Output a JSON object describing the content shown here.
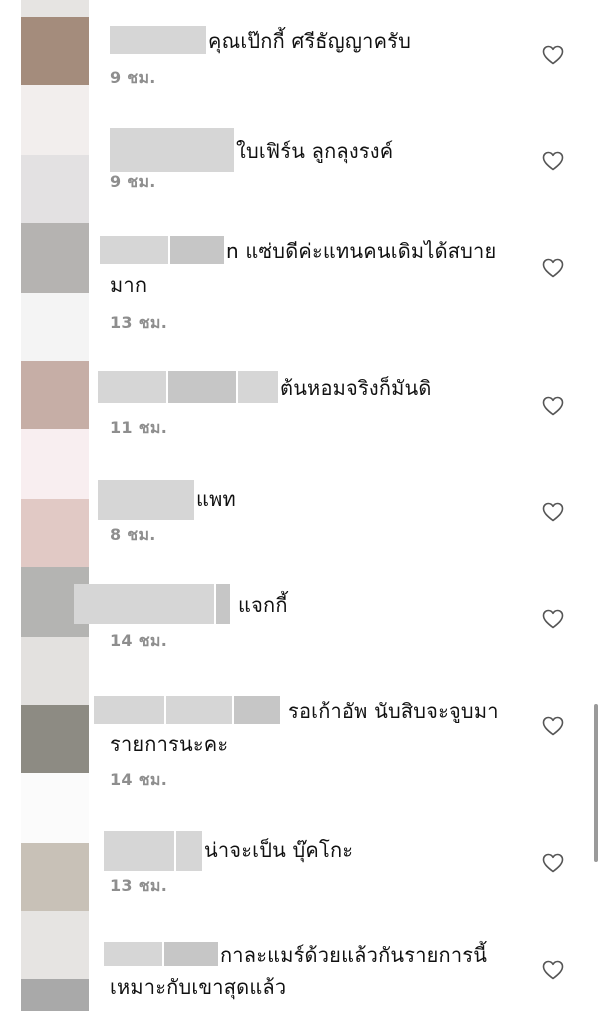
{
  "avatar_colors": [
    "#a48c7c",
    "#f2eeed",
    "#e3e1e2",
    "#b5b3b1",
    "#f4f4f4",
    "#c6aea6",
    "#f8eef0",
    "#e1c9c5",
    "#b4b4b2",
    "#e3e1df",
    "#8d8b83",
    "#fbfbfb",
    "#c8c1b7",
    "#e6e4e2",
    "#a9a9a9"
  ],
  "comments": [
    {
      "text_1": "คุณเป๊กกี้ ศรีธัญญาครับ",
      "text_2": "",
      "time": "9 ชม."
    },
    {
      "text_1": "ใบเฟิร์น ลูกลุงรงค์",
      "text_2": "",
      "time": "9 ชม."
    },
    {
      "text_1": "n แซ่บดีค่ะแทนคนเดิมได้สบาย",
      "text_2": "มาก",
      "time": "13 ชม."
    },
    {
      "text_1": "ต้นหอมจริงก็มันดิ",
      "text_2": "",
      "time": "11 ชม."
    },
    {
      "text_1": "แพท",
      "text_2": "",
      "time": "8 ชม."
    },
    {
      "text_1": "แจกกี้",
      "text_2": "",
      "time": "14 ชม."
    },
    {
      "text_1": "รอเก้าอัพ นับสิบจะจูบมา",
      "text_2": "รายการนะคะ",
      "time": "14 ชม."
    },
    {
      "text_1": "น่าจะเป็น บุ๊คโกะ",
      "text_2": "",
      "time": "13 ชม."
    },
    {
      "text_1": "กาละแมร์ด้วยแล้วกันรายการนี้",
      "text_2": "เหมาะกับเขาสุดแล้ว",
      "time": ""
    }
  ],
  "icons": {
    "like": "heart-outline-icon"
  },
  "colors": {
    "text": "#111111",
    "timestamp": "#8e8e8e",
    "icon": "#555555",
    "redaction": "#d6d6d6"
  }
}
